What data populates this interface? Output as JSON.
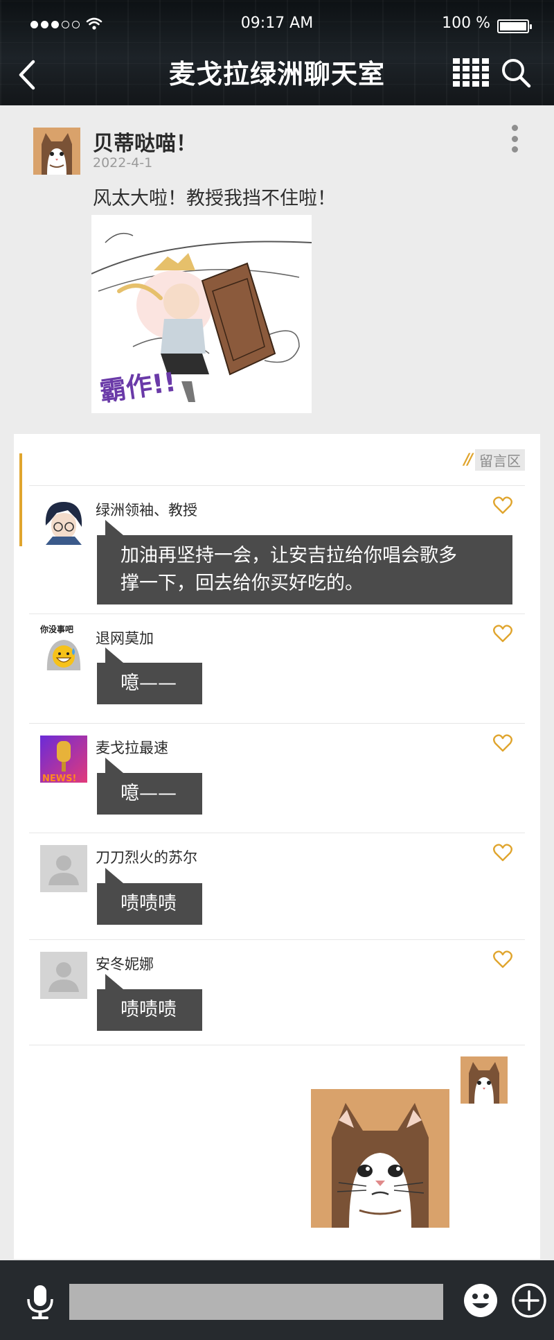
{
  "status_bar": {
    "time": "09:17 AM",
    "battery": "100 %"
  },
  "header": {
    "title": "麦戈拉绿洲聊天室"
  },
  "post": {
    "author": "贝蒂哒喵！",
    "date": "2022-4-1",
    "text": "风太大啦！教授我挡不住啦！",
    "image_caption": "霸作!!"
  },
  "comments_section": {
    "label": "留言区"
  },
  "comments": [
    {
      "name": "绿洲领袖、教授",
      "text_lines": [
        "加油再坚持一会，让安吉拉给你唱会歌多",
        "撑一下，回去给你买好吃的。"
      ]
    },
    {
      "name": "退网莫加",
      "avatar_text": "你没事吧",
      "text": "噫——"
    },
    {
      "name": "麦戈拉最速",
      "avatar_text": "NEWS!",
      "text": "噫——"
    },
    {
      "name": "刀刀烈火的苏尔",
      "text": "啧啧啧"
    },
    {
      "name": "安冬妮娜",
      "text": "啧啧啧"
    }
  ],
  "colors": {
    "accent": "#e0a52e",
    "bubble": "#4b4b4b",
    "header_bg": "#1a1f23",
    "bottom_bar": "#262a2e"
  },
  "icons": [
    "back-icon",
    "grid-icon",
    "search-icon",
    "more-icon",
    "heart-icon",
    "mic-icon",
    "emoji-icon",
    "plus-icon"
  ]
}
